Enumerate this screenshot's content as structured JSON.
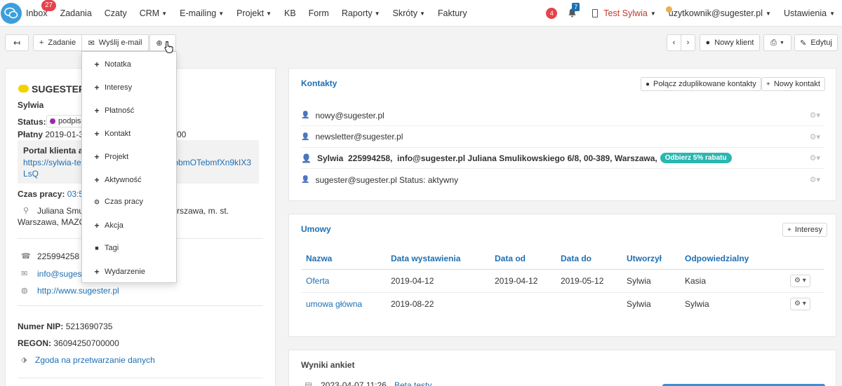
{
  "nav": {
    "items": [
      {
        "label": "Inbox",
        "badge": "27"
      },
      {
        "label": "Zadania"
      },
      {
        "label": "Czaty"
      },
      {
        "label": "CRM",
        "caret": true
      },
      {
        "label": "E-mailing",
        "caret": true
      },
      {
        "label": "Projekt",
        "caret": true
      },
      {
        "label": "KB"
      },
      {
        "label": "Form"
      },
      {
        "label": "Raporty",
        "caret": true
      },
      {
        "label": "Skróty",
        "caret": true
      },
      {
        "label": "Faktury"
      }
    ],
    "alerts_count": "4",
    "notifications_count": "7",
    "test_user": "Test Sylwia",
    "account": "uzytkownik@sugester.pl",
    "settings": "Ustawienia"
  },
  "toolbar": {
    "zadanie": "Zadanie",
    "send_email": "Wyślij e-mail",
    "new_client": "Nowy klient",
    "edit": "Edytuj"
  },
  "dropdown_items": [
    {
      "label": "Notatka",
      "icon": "plus-icon",
      "glyph": "+"
    },
    {
      "label": "Interesy",
      "icon": "plus-icon",
      "glyph": "+"
    },
    {
      "label": "Płatność",
      "icon": "plus-icon",
      "glyph": "+"
    },
    {
      "label": "Kontakt",
      "icon": "plus-icon",
      "glyph": "+"
    },
    {
      "label": "Projekt",
      "icon": "plus-icon",
      "glyph": "+"
    },
    {
      "label": "Aktywność",
      "icon": "plus-icon",
      "glyph": "+"
    },
    {
      "label": "Czas pracy",
      "icon": "clock-icon",
      "glyph": "⊙"
    },
    {
      "label": "Akcja",
      "icon": "plus-icon",
      "glyph": "+"
    },
    {
      "label": "Tagi",
      "icon": "bookmark-icon",
      "glyph": "■"
    },
    {
      "label": "Wydarzenie",
      "icon": "plus-icon",
      "glyph": "+"
    }
  ],
  "client": {
    "name": "SUGESTER",
    "owner": "Sylwia",
    "status_label": "Status:",
    "status_value": "podpisa",
    "paid_label": "Płatny",
    "paid_value": "2019-01-31",
    "paid_tail": "00",
    "portal_title": "Portal klienta a",
    "portal_link_a": "https://sylwia-tes",
    "portal_link_b": "/bbmOTebmfXn9kIX3",
    "portal_link_c": "LsQ",
    "work_time_label": "Czas pracy:",
    "work_time_value": "03:59",
    "address_a": "Juliana Smul",
    "address_b": "rszawa, m. st.",
    "address_c": "Warszawa, MAZOW",
    "phone": "225994258",
    "email": "info@sugest",
    "website": "http://www.sugester.pl",
    "nip_label": "Numer NIP:",
    "nip_value": "5213690735",
    "regon_label": "REGON:",
    "regon_value": "36094250700000",
    "consent": "Zgoda na przetwarzanie danych"
  },
  "contacts": {
    "title": "Kontakty",
    "merge_button": "Połącz zduplikowane kontakty",
    "new_contact_button": "Nowy kontakt",
    "rows": [
      {
        "text": "nowy@sugester.pl",
        "bold": false
      },
      {
        "text": "newsletter@sugester.pl",
        "bold": false
      },
      {
        "text": "Sylwia  225994258,  info@sugester.pl Juliana Smulikowskiego 6/8, 00-389, Warszawa,",
        "bold": true,
        "badge": "Odbierz 5% rabatu"
      },
      {
        "text": "sugester@sugester.pl Status: aktywny",
        "bold": false
      }
    ]
  },
  "umowy": {
    "title": "Umowy",
    "interesy_button": "Interesy",
    "headers": [
      "Nazwa",
      "Data wystawienia",
      "Data od",
      "Data do",
      "Utworzył",
      "Odpowiedzialny"
    ],
    "rows": [
      [
        "Oferta",
        "2019-04-12",
        "2019-04-12",
        "2019-05-12",
        "Sylwia",
        "Kasia"
      ],
      [
        "umowa główna",
        "2019-08-22",
        "",
        "",
        "Sylwia",
        "Sylwia"
      ]
    ]
  },
  "ankiety": {
    "title": "Wyniki ankiet",
    "first_row_date": "2023-04-07 11:26",
    "first_row_link": "Beta testy"
  }
}
